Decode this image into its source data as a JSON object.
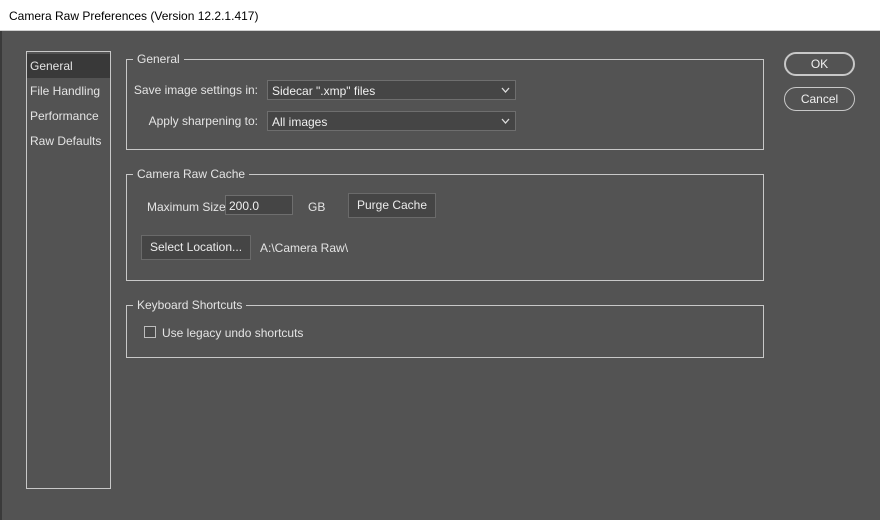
{
  "window": {
    "title": "Camera Raw Preferences  (Version 12.2.1.417)"
  },
  "sidebar": {
    "items": [
      {
        "label": "General",
        "active": true
      },
      {
        "label": "File Handling",
        "active": false
      },
      {
        "label": "Performance",
        "active": false
      },
      {
        "label": "Raw Defaults",
        "active": false
      }
    ]
  },
  "general": {
    "legend": "General",
    "save_settings_label": "Save image settings in:",
    "save_settings_value": "Sidecar \".xmp\" files",
    "sharpening_label": "Apply sharpening to:",
    "sharpening_value": "All images"
  },
  "cache": {
    "legend": "Camera Raw Cache",
    "max_size_label": "Maximum Size:",
    "max_size_value": "200.0",
    "unit": "GB",
    "purge_label": "Purge Cache",
    "select_location_label": "Select Location...",
    "location_path": "A:\\Camera Raw\\"
  },
  "shortcuts": {
    "legend": "Keyboard Shortcuts",
    "legacy_undo_label": "Use legacy undo shortcuts",
    "legacy_undo_checked": false
  },
  "actions": {
    "ok_label": "OK",
    "cancel_label": "Cancel"
  },
  "icons": {
    "dropdown": "chevron-down-icon",
    "checkbox": "checkbox-unchecked-icon"
  },
  "colors": {
    "background": "#535353",
    "selected_item": "#393939",
    "border": "#c8c8c8"
  }
}
